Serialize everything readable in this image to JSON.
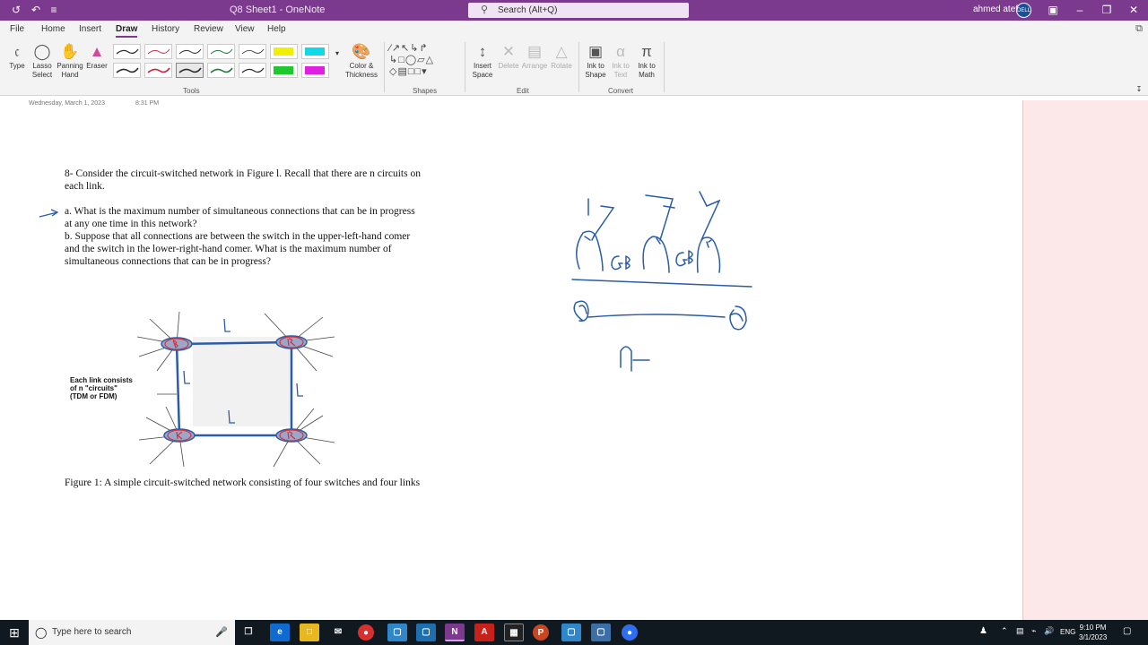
{
  "titlebar": {
    "title": "Q8 Sheet1 - OneNote",
    "search_placeholder": "Search (Alt+Q)",
    "user": "ahmed atef",
    "avatar_text": "DELL"
  },
  "menu": {
    "items": [
      "File",
      "Home",
      "Insert",
      "Draw",
      "History",
      "Review",
      "View",
      "Help"
    ],
    "active": "Draw"
  },
  "ribbon": {
    "tools": {
      "type": "Type",
      "lasso": [
        "Lasso",
        "Select"
      ],
      "panning": [
        "Panning",
        "Hand"
      ],
      "eraser": "Eraser",
      "color_thickness": [
        "Color &",
        "Thickness"
      ],
      "group_label": "Tools"
    },
    "shapes": {
      "group_label": "Shapes"
    },
    "edit": {
      "insert_space": [
        "Insert",
        "Space"
      ],
      "delete": "Delete",
      "arrange": "Arrange",
      "rotate": "Rotate",
      "group_label": "Edit"
    },
    "convert": {
      "ink_to_shape": [
        "Ink to",
        "Shape"
      ],
      "ink_to_text": [
        "Ink to",
        "Text"
      ],
      "ink_to_math": [
        "Ink to",
        "Math"
      ],
      "group_label": "Convert"
    },
    "pen_colors": [
      "#2b2b2b",
      "#c8304a",
      "#2b2b2b",
      "#1f7a3a",
      "#2b2b2b",
      "#e8e800",
      "#10d8e8",
      "#2b2b2b",
      "#d0203a",
      "#2b2b2b",
      "#1f7a3a",
      "#2b2b2b",
      "#20c830",
      "#e020e0"
    ]
  },
  "page": {
    "date": "Wednesday, March 1, 2023",
    "time": "8:31 PM",
    "question_intro": [
      "8- Consider the circuit-switched network in Figure l. Recall that there are n circuits on",
      "each link."
    ],
    "question_a": [
      "a. What is the maximum number of simultaneous connections that can be in progress",
      "at any one time in this network?"
    ],
    "question_b": [
      "b. Suppose that all connections are between the switch in the upper-left-hand comer",
      "and the switch in the lower-right-hand comer. What is the maximum number of",
      "simultaneous connections that can be in progress?"
    ],
    "figure_note": [
      "Each link consists",
      "of n \"circuits\"",
      "(TDM or FDM)"
    ],
    "figure_caption": "Figure 1: A simple circuit-switched network consisting of four switches and four links"
  },
  "taskbar": {
    "search_placeholder": "Type here to search",
    "apps": [
      "task-view",
      "edge",
      "file-explorer",
      "mail",
      "chrome",
      "app-blue-1",
      "app-blue-2",
      "onenote",
      "acrobat",
      "calculator",
      "powerpoint",
      "app-blue-3",
      "app-blue-4",
      "zoom"
    ],
    "language": "ENG",
    "time": "9:10 PM",
    "date": "3/1/2023"
  },
  "colors": {
    "accent": "#7b3a8e",
    "ink_blue": "#2a5ca8",
    "ink_red": "#d8303a",
    "side_pane": "#fce8e8"
  }
}
